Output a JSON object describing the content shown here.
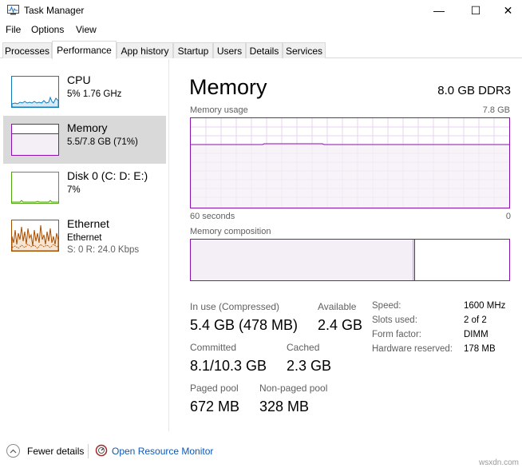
{
  "window": {
    "title": "Task Manager",
    "minimize": "—",
    "maximize": "☐",
    "close": "✕"
  },
  "menu": [
    "File",
    "Options",
    "View"
  ],
  "tabs": [
    {
      "label": "Processes",
      "active": false
    },
    {
      "label": "Performance",
      "active": true
    },
    {
      "label": "App history",
      "active": false
    },
    {
      "label": "Startup",
      "active": false
    },
    {
      "label": "Users",
      "active": false
    },
    {
      "label": "Details",
      "active": false
    },
    {
      "label": "Services",
      "active": false
    }
  ],
  "sidebar": {
    "items": [
      {
        "name": "CPU",
        "detail": "5% 1.76 GHz",
        "detail2": "",
        "color": "#117dbb",
        "selected": false
      },
      {
        "name": "Memory",
        "detail": "5.5/7.8 GB (71%)",
        "detail2": "",
        "color": "#8b12ae",
        "selected": true
      },
      {
        "name": "Disk 0 (C: D: E:)",
        "detail": "7%",
        "detail2": "",
        "color": "#4da60c",
        "selected": false
      },
      {
        "name": "Ethernet",
        "detail": "Ethernet",
        "detail2": "S: 0 R: 24.0 Kbps",
        "color": "#a74f01",
        "selected": false
      }
    ]
  },
  "main": {
    "title": "Memory",
    "memory_type": "8.0 GB DDR3",
    "usage_label": "Memory usage",
    "usage_max": "7.8 GB",
    "time_label": "60 seconds",
    "time_end": "0",
    "composition_label": "Memory composition",
    "in_use_fraction": 0.7,
    "modified_fraction": 0.005,
    "stats": {
      "in_use_label": "In use (Compressed)",
      "in_use_value": "5.4 GB (478 MB)",
      "available_label": "Available",
      "available_value": "2.4 GB",
      "committed_label": "Committed",
      "committed_value": "8.1/10.3 GB",
      "cached_label": "Cached",
      "cached_value": "2.3 GB",
      "paged_label": "Paged pool",
      "paged_value": "672 MB",
      "nonpaged_label": "Non-paged pool",
      "nonpaged_value": "328 MB"
    },
    "info": {
      "speed_label": "Speed:",
      "speed_value": "1600 MHz",
      "slots_label": "Slots used:",
      "slots_value": "2 of 2",
      "form_label": "Form factor:",
      "form_value": "DIMM",
      "reserved_label": "Hardware reserved:",
      "reserved_value": "178 MB"
    }
  },
  "footer": {
    "fewer_details": "Fewer details",
    "open_monitor": "Open Resource Monitor"
  },
  "watermark": "wsxdn.com",
  "icons": {
    "app": "task-manager-icon",
    "fewer": "chevron-up-icon",
    "monitor": "resource-monitor-icon"
  }
}
